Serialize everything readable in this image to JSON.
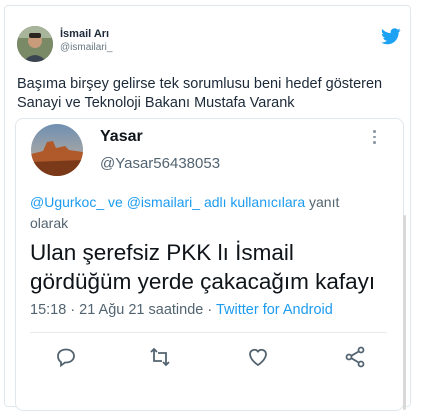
{
  "tweet": {
    "author_name": "İsmail Arı",
    "author_handle": "@ismailari_",
    "text_line1": "Başıma birşey gelirse tek sorumlusu beni hedef gösteren",
    "text_line2": "Sanayi ve Teknoloji Bakanı Mustafa Varank"
  },
  "embedded": {
    "name": "Yasar",
    "handle": "@Yasar56438053",
    "reply_mention1": "@Ugurkoc_",
    "reply_and": " ve ",
    "reply_mention2": "@ismailari_",
    "reply_suffix": " adlı kullanıcılara",
    "reply_end": " yanıt olarak",
    "text_line1": "Ulan şerefsiz PKK lı İsmail",
    "text_line2": "gördüğüm yerde çakacağım kafayı",
    "timestamp": "15:18 · 21 Ağu 21 saatinde · ",
    "source": "Twitter for Android"
  },
  "colors": {
    "link_blue": "#1d9bf0",
    "muted": "#536471",
    "bird": "#1da1f2"
  }
}
